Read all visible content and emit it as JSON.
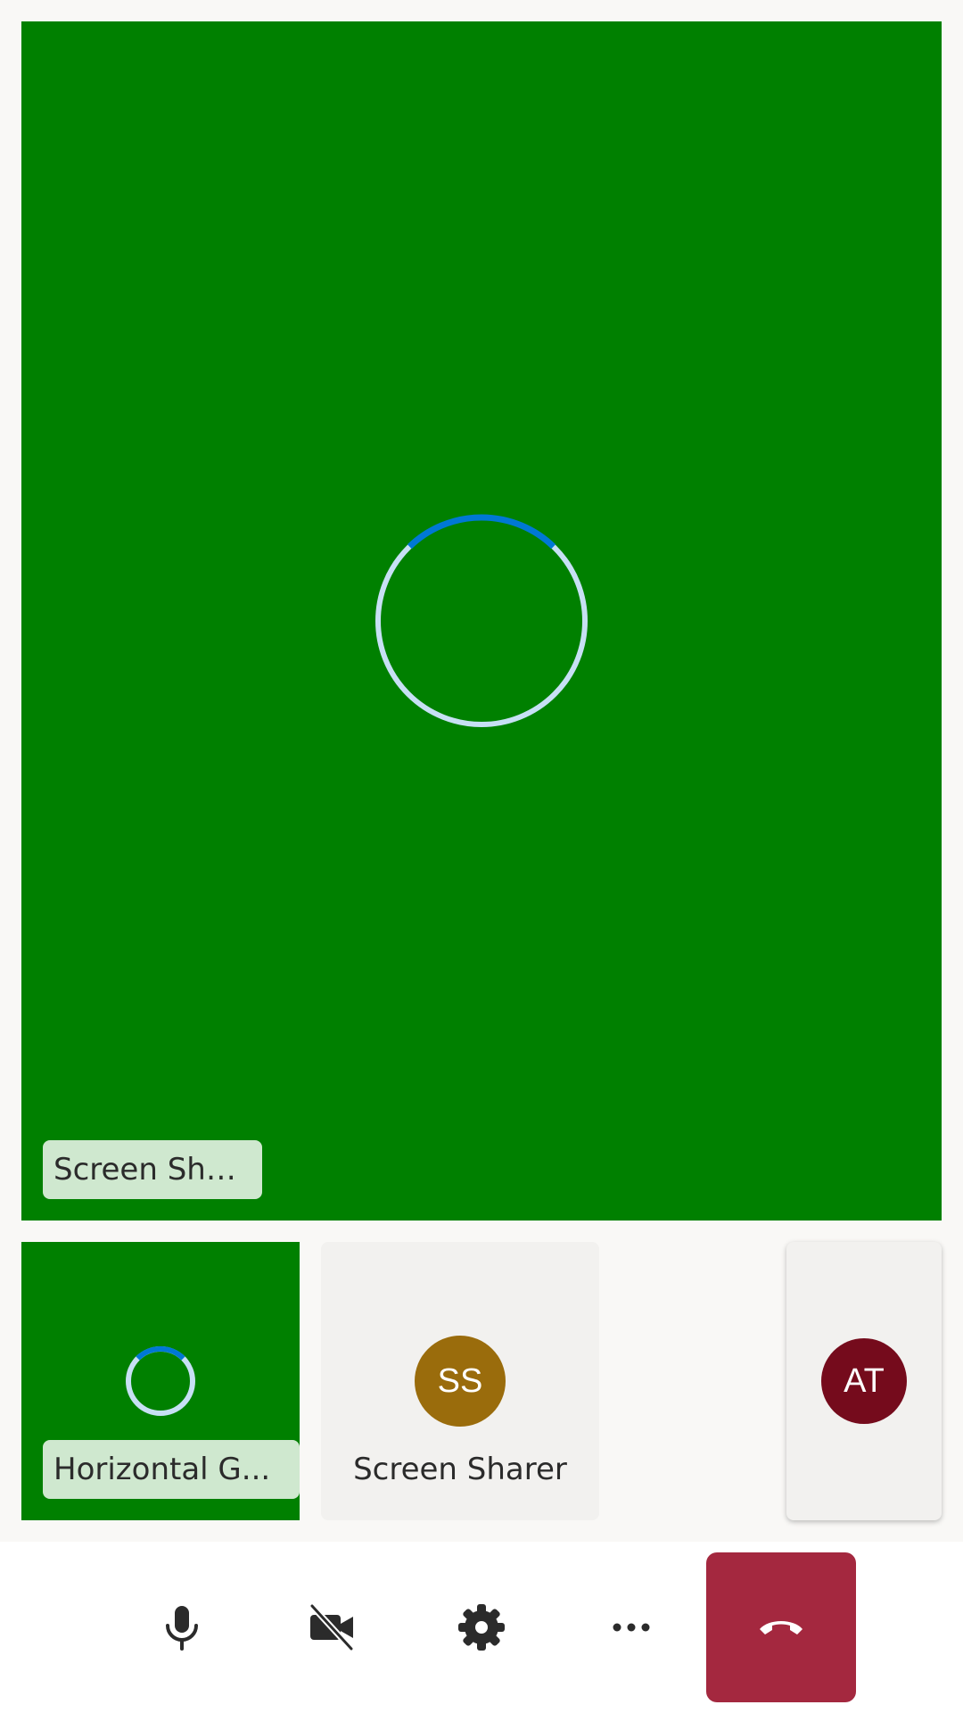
{
  "main_stage": {
    "participant_name": "Screen Sharer",
    "background_color": "#008000",
    "state": "loading-spinner"
  },
  "gallery": {
    "tiles": [
      {
        "name": "Horizontal G...",
        "type": "video",
        "state": "loading-spinner",
        "background_color": "#008000"
      },
      {
        "name": "Screen Sharer",
        "initials": "SS",
        "type": "avatar",
        "avatar_color": "#9a6c0c"
      },
      {
        "initials": "AT",
        "type": "avatar",
        "avatar_color": "#750b1c"
      }
    ]
  },
  "controls": {
    "mic": {
      "icon": "microphone-icon"
    },
    "camera": {
      "icon": "video-off-icon"
    },
    "settings": {
      "icon": "gear-icon"
    },
    "more": {
      "icon": "more-options-icon"
    },
    "hangup": {
      "icon": "phone-hangup-icon",
      "color": "#a4283f"
    }
  },
  "colors": {
    "spinner_track": "#c7e0f4",
    "spinner_accent": "#0078d4",
    "name_tag_bg": "#cfe8cf"
  }
}
